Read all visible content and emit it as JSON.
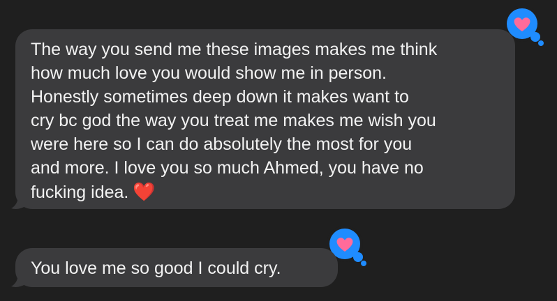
{
  "conversation": {
    "messages": [
      {
        "lines": [
          "The way you send me these images makes me think",
          "how much love you would show me in person.",
          "Honestly sometimes deep down it makes want to",
          "cry bc god the way you treat me makes me wish you",
          "were here so I can do absolutely the most for you",
          "and more. I love you so much Ahmed, you have no",
          "fucking idea."
        ],
        "emoji": "❤️",
        "tapback": "heart-icon"
      },
      {
        "lines": [
          "You love me so good I could cry."
        ],
        "tapback": "heart-icon"
      }
    ]
  },
  "colors": {
    "background": "#1f1f1f",
    "bubble": "#3b3b3d",
    "text": "#f2f2f2",
    "tapback_bg": "#1f8cff",
    "tapback_heart": "#ff6b9a",
    "emoji_heart": "#e0202a"
  }
}
